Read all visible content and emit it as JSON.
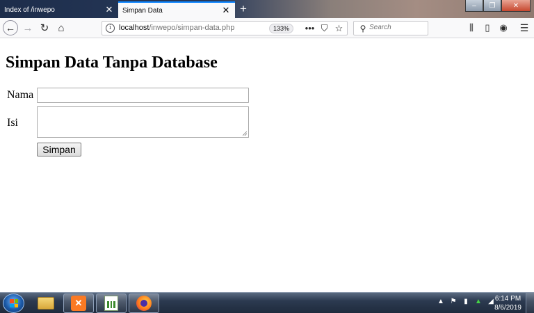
{
  "browser": {
    "tabs": [
      {
        "title": "Index of /inwepo",
        "active": false
      },
      {
        "title": "Simpan Data",
        "active": true
      }
    ],
    "new_tab_icon": "plus-icon",
    "url_host": "localhost",
    "url_path": "/inwepo/simpan-data.php",
    "zoom": "133%",
    "search_placeholder": "Search",
    "accent_color": "#0a84ff"
  },
  "page": {
    "heading": "Simpan Data Tanpa Database",
    "form": {
      "nama_label": "Nama",
      "nama_value": "",
      "isi_label": "Isi",
      "isi_value": "",
      "submit_label": "Simpan"
    }
  },
  "taskbar": {
    "apps": [
      "folder-icon",
      "xampp-icon",
      "spreadsheet-icon",
      "firefox-icon"
    ],
    "time": "6:14 PM",
    "date": "8/6/2019"
  }
}
